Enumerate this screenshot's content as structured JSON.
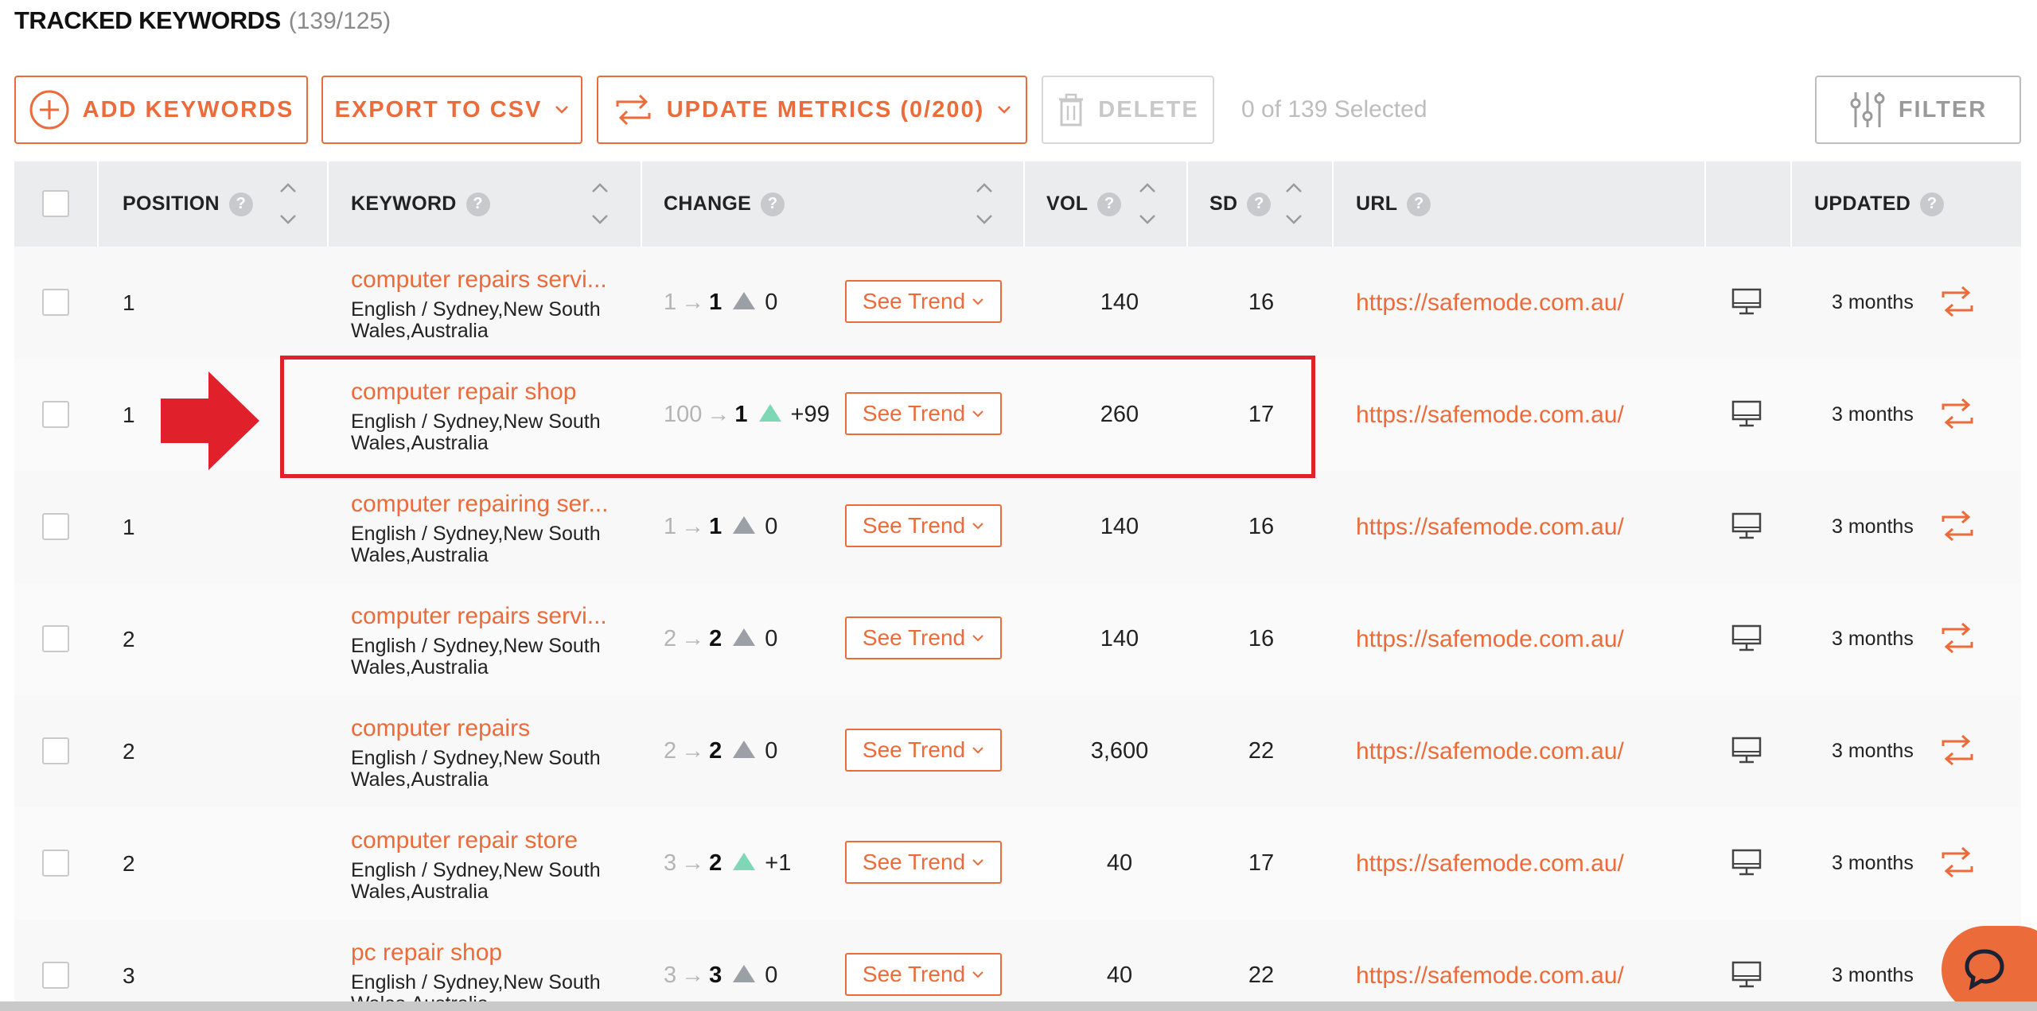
{
  "header": {
    "title": "TRACKED KEYWORDS",
    "count": "(139/125)"
  },
  "toolbar": {
    "add_label": "ADD KEYWORDS",
    "export_label": "EXPORT TO CSV",
    "update_label": "UPDATE METRICS (0/200)",
    "delete_label": "DELETE",
    "selected_text": "0 of 139 Selected",
    "filter_label": "FILTER"
  },
  "columns": {
    "position": "POSITION",
    "keyword": "KEYWORD",
    "change": "CHANGE",
    "vol": "VOL",
    "sd": "SD",
    "url": "URL",
    "updated": "UPDATED",
    "help": "?"
  },
  "see_trend_label": "See Trend",
  "rows": [
    {
      "position": "1",
      "keyword": "computer repairs servi...",
      "location": "English / Sydney,New South Wales,Australia",
      "from": "1",
      "arrow": "→",
      "to": "1",
      "trend": "neutral",
      "delta": "0",
      "vol": "140",
      "sd": "16",
      "url": "https://safemode.com.au/",
      "updated": "3 months"
    },
    {
      "position": "1",
      "keyword": "computer repair shop",
      "location": "English / Sydney,New South Wales,Australia",
      "from": "100",
      "arrow": "→",
      "to": "1",
      "trend": "up",
      "delta": "+99",
      "vol": "260",
      "sd": "17",
      "url": "https://safemode.com.au/",
      "updated": "3 months"
    },
    {
      "position": "1",
      "keyword": "computer repairing ser...",
      "location": "English / Sydney,New South Wales,Australia",
      "from": "1",
      "arrow": "→",
      "to": "1",
      "trend": "neutral",
      "delta": "0",
      "vol": "140",
      "sd": "16",
      "url": "https://safemode.com.au/",
      "updated": "3 months"
    },
    {
      "position": "2",
      "keyword": "computer repairs servi...",
      "location": "English / Sydney,New South Wales,Australia",
      "from": "2",
      "arrow": "→",
      "to": "2",
      "trend": "neutral",
      "delta": "0",
      "vol": "140",
      "sd": "16",
      "url": "https://safemode.com.au/",
      "updated": "3 months"
    },
    {
      "position": "2",
      "keyword": "computer repairs",
      "location": "English / Sydney,New South Wales,Australia",
      "from": "2",
      "arrow": "→",
      "to": "2",
      "trend": "neutral",
      "delta": "0",
      "vol": "3,600",
      "sd": "22",
      "url": "https://safemode.com.au/",
      "updated": "3 months"
    },
    {
      "position": "2",
      "keyword": "computer repair store",
      "location": "English / Sydney,New South Wales,Australia",
      "from": "3",
      "arrow": "→",
      "to": "2",
      "trend": "up",
      "delta": "+1",
      "vol": "40",
      "sd": "17",
      "url": "https://safemode.com.au/",
      "updated": "3 months"
    },
    {
      "position": "3",
      "keyword": "pc repair shop",
      "location": "English / Sydney,New South Wales,Australia",
      "from": "3",
      "arrow": "→",
      "to": "3",
      "trend": "neutral",
      "delta": "0",
      "vol": "40",
      "sd": "22",
      "url": "https://safemode.com.au/",
      "updated": "3 months"
    }
  ],
  "colors": {
    "accent": "#ec6b3a",
    "highlight": "#e0202b",
    "trend_up": "#7ed8b5",
    "trend_neutral": "#9aa0a6"
  }
}
